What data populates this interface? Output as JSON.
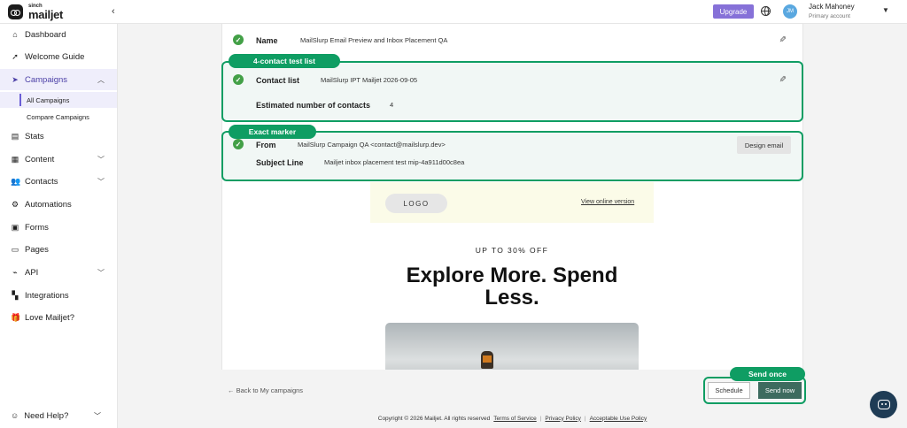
{
  "brand": {
    "sinch": "sinch",
    "mailjet": "mailjet"
  },
  "header": {
    "collapse_icon": "‹",
    "upgrade_label": "Upgrade",
    "user": {
      "initials": "JM",
      "name": "Jack Mahoney",
      "role": "Primary account"
    }
  },
  "sidebar": {
    "items": [
      {
        "label": "Dashboard",
        "icon": "home-icon"
      },
      {
        "label": "Welcome Guide",
        "icon": "rocket-icon"
      },
      {
        "label": "Campaigns",
        "icon": "send-icon"
      },
      {
        "label": "Stats",
        "icon": "stats-icon"
      },
      {
        "label": "Content",
        "icon": "content-icon"
      },
      {
        "label": "Contacts",
        "icon": "contacts-icon"
      },
      {
        "label": "Automations",
        "icon": "automations-icon"
      },
      {
        "label": "Forms",
        "icon": "forms-icon"
      },
      {
        "label": "Pages",
        "icon": "pages-icon"
      },
      {
        "label": "API",
        "icon": "api-icon"
      },
      {
        "label": "Integrations",
        "icon": "integrations-icon"
      },
      {
        "label": "Love Mailjet?",
        "icon": "gift-icon"
      }
    ],
    "sub_items": [
      {
        "label": "All Campaigns"
      },
      {
        "label": "Compare Campaigns"
      }
    ],
    "help_label": "Need Help?"
  },
  "campaign": {
    "name_label": "Name",
    "name_value": "MailSlurp Email Preview and Inbox Placement QA",
    "contact_list_label": "Contact list",
    "contact_list_value": "MailSlurp IPT Mailjet 2026-09-05",
    "estimated_label": "Estimated number of contacts",
    "estimated_value": "4",
    "from_label": "From",
    "from_value": "MailSlurp Campaign QA <contact@mailslurp.dev>",
    "subject_label": "Subject Line",
    "subject_value": "Mailjet inbox placement test mip-4a911d00c8ea",
    "design_button": "Design email"
  },
  "annotations": {
    "contact_tag": "4-contact test list",
    "marker_tag": "Exact marker",
    "send_tag": "Send once"
  },
  "email_preview": {
    "logo_text": "LOGO",
    "view_online": "View online version",
    "promo": "UP TO 30% OFF",
    "headline": "Explore More. Spend Less."
  },
  "actions": {
    "back_link": "← Back to My campaigns",
    "schedule": "Schedule",
    "send_now": "Send now"
  },
  "footer": {
    "copyright": "Copyright © 2026 Mailjet. All rights reserved",
    "terms": "Terms of Service",
    "privacy": "Privacy Policy",
    "acceptable": "Acceptable Use Policy"
  },
  "colors": {
    "accent": "#8671d8",
    "highlight_green": "#0f9d63",
    "check_green": "#43a047",
    "send_button": "#3d6b5f"
  }
}
